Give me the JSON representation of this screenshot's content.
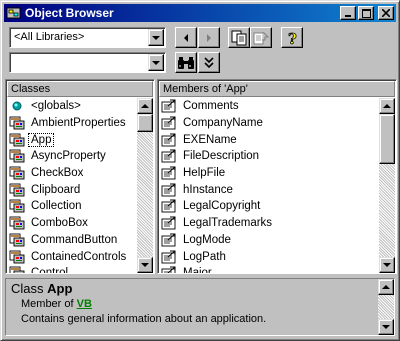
{
  "window": {
    "title": "Object Browser"
  },
  "toolbar": {
    "library_select_value": "<All Libraries>",
    "search_value": ""
  },
  "classes": {
    "header": "Classes",
    "items": [
      {
        "label": "<globals>",
        "icon": "globals-icon"
      },
      {
        "label": "AmbientProperties",
        "icon": "class-icon"
      },
      {
        "label": "App",
        "icon": "class-icon",
        "selected": true
      },
      {
        "label": "AsyncProperty",
        "icon": "class-icon"
      },
      {
        "label": "CheckBox",
        "icon": "class-icon"
      },
      {
        "label": "Clipboard",
        "icon": "class-icon"
      },
      {
        "label": "Collection",
        "icon": "class-icon"
      },
      {
        "label": "ComboBox",
        "icon": "class-icon"
      },
      {
        "label": "CommandButton",
        "icon": "class-icon"
      },
      {
        "label": "ContainedControls",
        "icon": "class-icon"
      },
      {
        "label": "Control",
        "icon": "class-icon"
      }
    ]
  },
  "members": {
    "header": "Members of 'App'",
    "items": [
      {
        "label": "Comments",
        "icon": "property-icon"
      },
      {
        "label": "CompanyName",
        "icon": "property-icon"
      },
      {
        "label": "EXEName",
        "icon": "property-icon"
      },
      {
        "label": "FileDescription",
        "icon": "property-icon"
      },
      {
        "label": "HelpFile",
        "icon": "property-icon"
      },
      {
        "label": "hInstance",
        "icon": "property-icon"
      },
      {
        "label": "LegalCopyright",
        "icon": "property-icon"
      },
      {
        "label": "LegalTrademarks",
        "icon": "property-icon"
      },
      {
        "label": "LogMode",
        "icon": "property-icon"
      },
      {
        "label": "LogPath",
        "icon": "property-icon"
      },
      {
        "label": "Major",
        "icon": "property-icon"
      }
    ]
  },
  "details": {
    "kind": "Class",
    "name": "App",
    "member_of_prefix": "Member of",
    "member_of_link": "VB",
    "description": "Contains general information about an application."
  },
  "colors": {
    "title_start": "#000080",
    "title_end": "#1084d0",
    "face": "#c0c0c0",
    "link": "#008000"
  }
}
